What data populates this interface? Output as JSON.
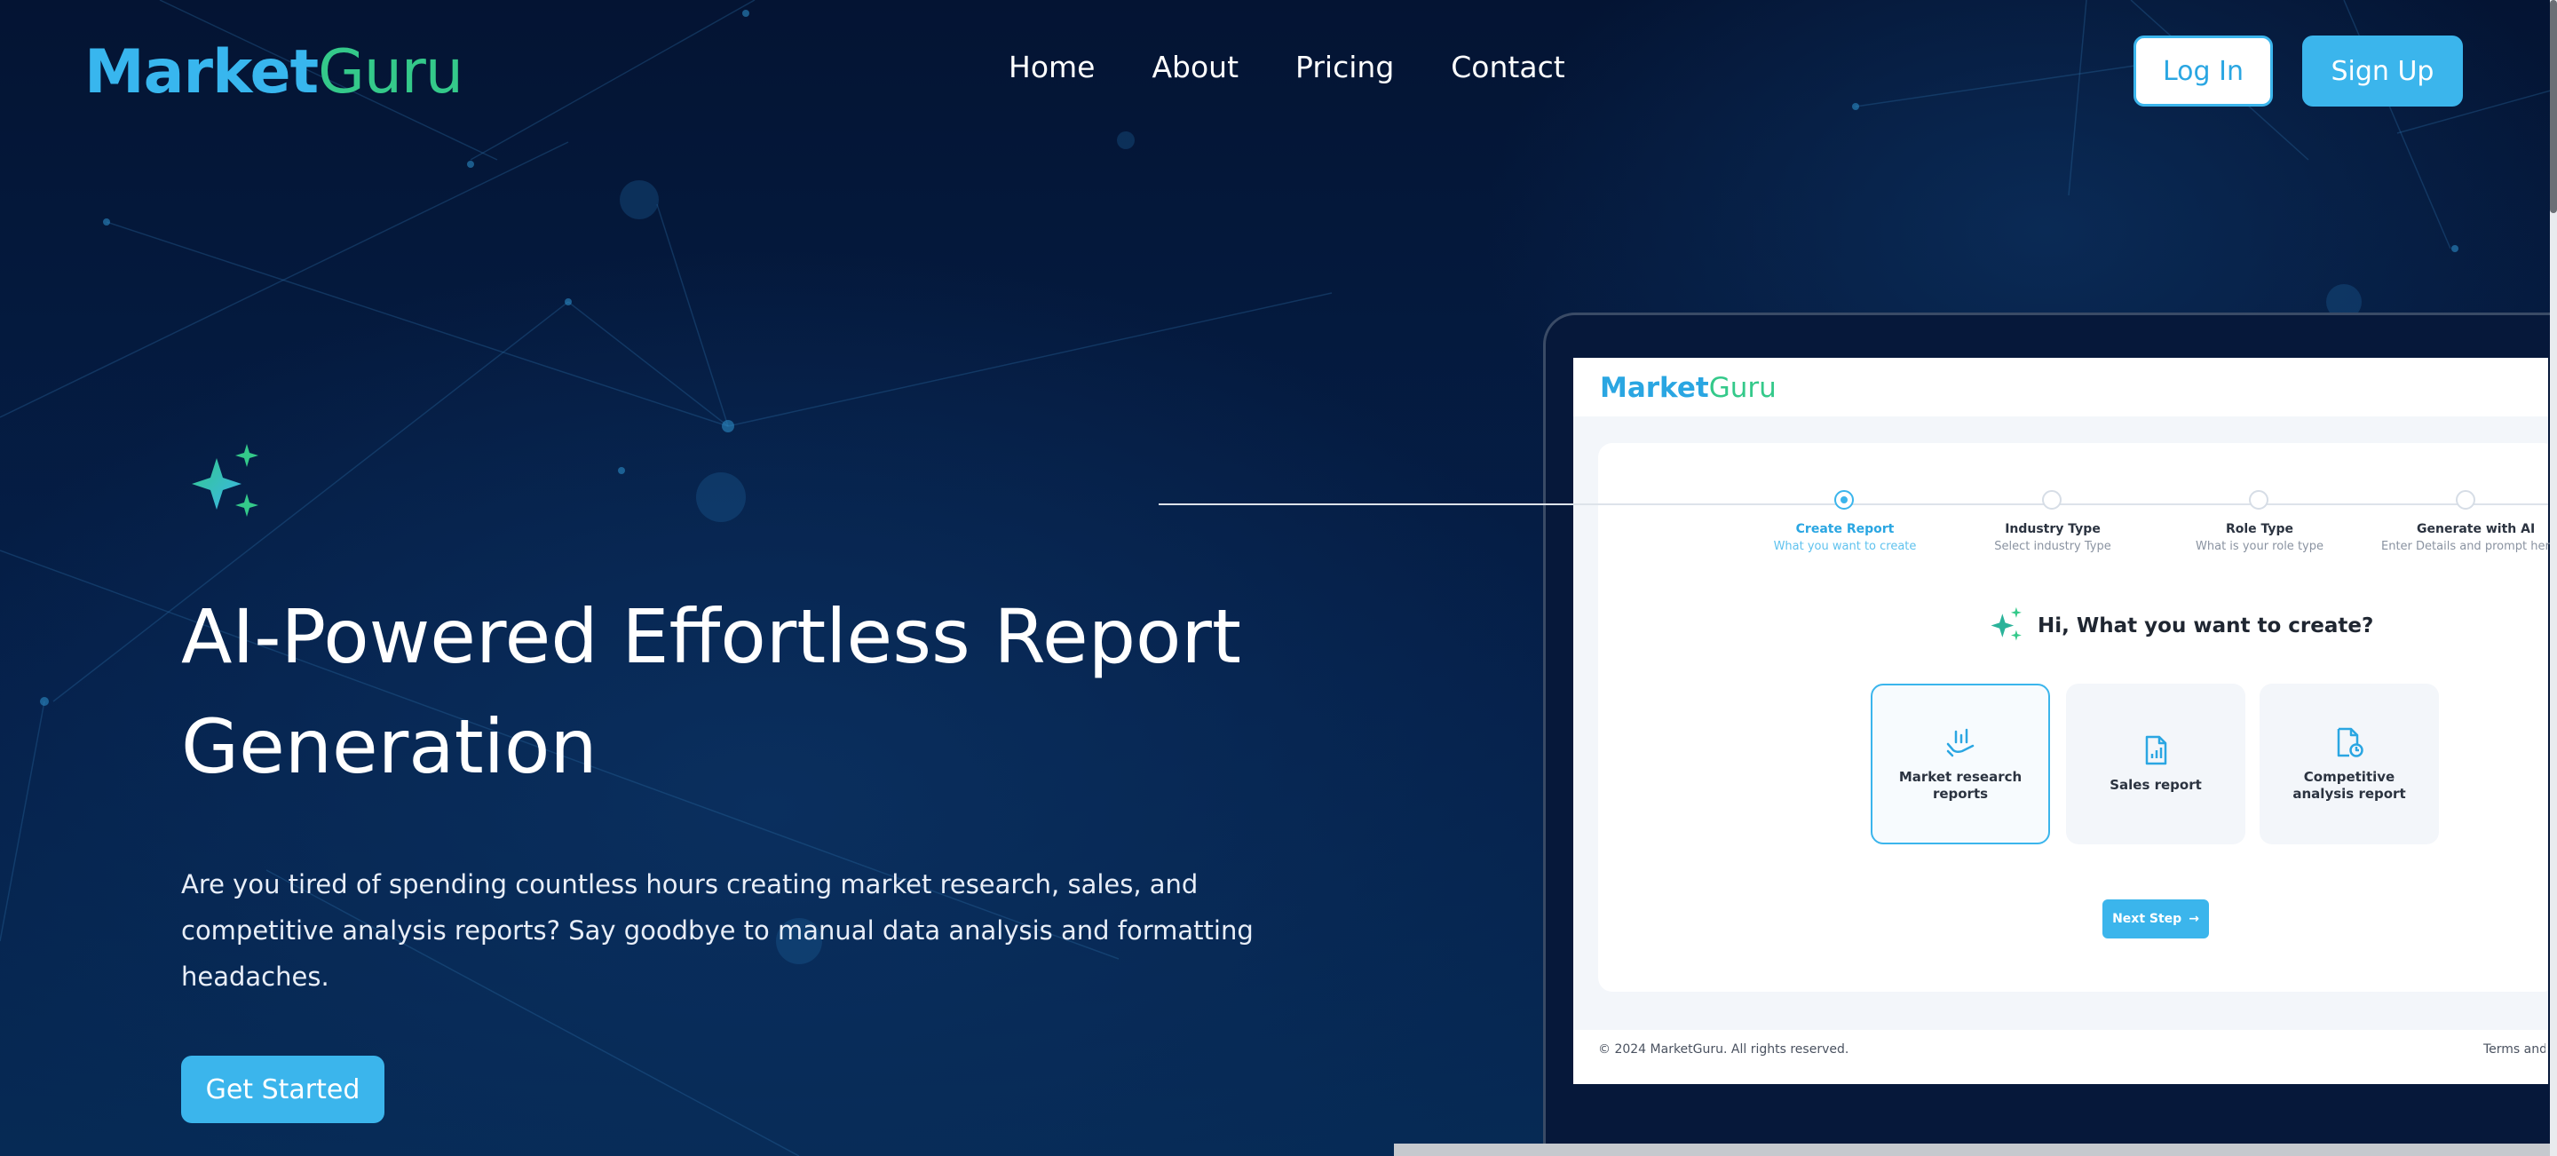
{
  "header": {
    "logo_part1": "Market",
    "logo_part2": "Guru",
    "nav": [
      "Home",
      "About",
      "Pricing",
      "Contact"
    ],
    "login_label": "Log In",
    "signup_label": "Sign Up"
  },
  "hero": {
    "title": "AI-Powered Effortless Report Generation",
    "description": "Are you tired of spending countless hours creating market research, sales, and competitive analysis reports? Say goodbye to manual data analysis and formatting headaches.",
    "cta_label": "Get Started"
  },
  "preview": {
    "logo_part1": "Market",
    "logo_part2": "Guru",
    "steps": [
      {
        "title": "Create Report",
        "sub": "What you want to create",
        "active": true
      },
      {
        "title": "Industry Type",
        "sub": "Select industry Type",
        "active": false
      },
      {
        "title": "Role Type",
        "sub": "What is your role type",
        "active": false
      },
      {
        "title": "Generate with AI",
        "sub": "Enter Details and prompt here",
        "active": false
      }
    ],
    "question": "Hi, What you want to create?",
    "options": [
      {
        "label": "Market research reports",
        "icon": "chart-hand-icon",
        "selected": true
      },
      {
        "label": "Sales report",
        "icon": "report-doc-icon",
        "selected": false
      },
      {
        "label": "Competitive analysis report",
        "icon": "analysis-doc-icon",
        "selected": false
      }
    ],
    "next_label": "Next Step",
    "copyright": "© 2024 MarketGuru. All rights reserved.",
    "terms": "Terms and Conditions"
  },
  "colors": {
    "accent_blue": "#3bb5ec",
    "accent_green": "#34c98a",
    "background": "#04163a"
  }
}
